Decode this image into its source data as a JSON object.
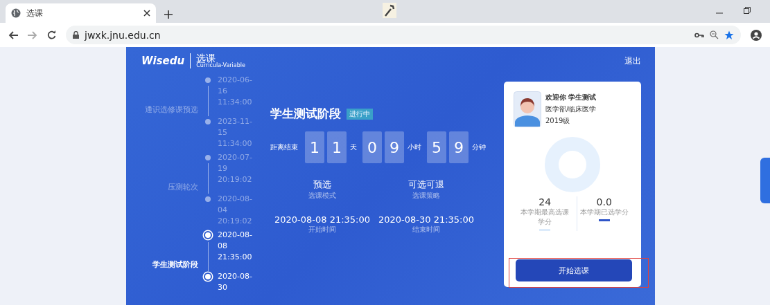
{
  "browser": {
    "tab": {
      "title": "选课"
    },
    "url": "jwxk.jnu.edu.cn"
  },
  "header": {
    "logo": "Wisedu",
    "app_name": "选课",
    "app_subtitle": "Curricula-Variable",
    "logout": "退出"
  },
  "timeline": [
    {
      "label": "通识选修课预选",
      "start": "2020-06-16 11:34:00",
      "end": "2023-11-15 11:34:00",
      "selected": false
    },
    {
      "label": "压测轮次",
      "start": "2020-07-19 20:19:02",
      "end": "2020-08-04 20:19:02",
      "selected": false
    },
    {
      "label": "学生测试阶段",
      "start": "2020-08-08 21:35:00",
      "end": "2020-08-30",
      "selected": true
    }
  ],
  "stage": {
    "title": "学生测试阶段",
    "status": "进行中",
    "countdown": {
      "label": "距离结束",
      "groups": [
        {
          "digits": [
            "1",
            "1"
          ],
          "unit": "天"
        },
        {
          "digits": [
            "0",
            "9"
          ],
          "unit": "小时"
        },
        {
          "digits": [
            "5",
            "9"
          ],
          "unit": "分钟"
        }
      ]
    },
    "info": [
      {
        "value": "预选",
        "caption": "选课模式"
      },
      {
        "value": "可选可退",
        "caption": "选课策略"
      },
      {
        "value": "2020-08-08 21:35:00",
        "caption": "开始时间"
      },
      {
        "value": "2020-08-30 21:35:00",
        "caption": "结束时间"
      }
    ]
  },
  "profile": {
    "greeting": "欢迎你 学生测试",
    "department": "医学部/临床医学",
    "grade": "2019级",
    "stats": [
      {
        "value": "24",
        "caption": "本学期最高选课学分",
        "color": "#dcebfb"
      },
      {
        "value": "0.0",
        "caption": "本学期已选学分",
        "color": "#2f55c8"
      }
    ],
    "start_button": "开始选课"
  }
}
